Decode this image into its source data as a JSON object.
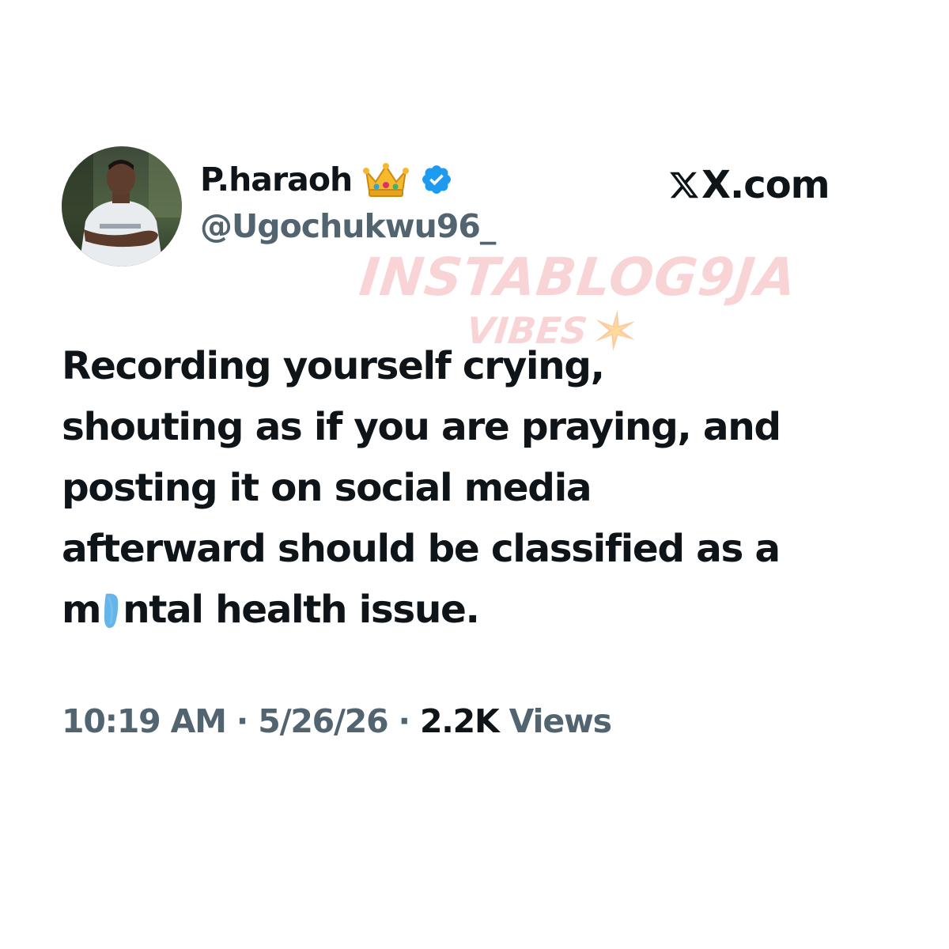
{
  "tweet": {
    "author": {
      "display_name": "P.haraoh",
      "handle": "@Ugochukwu96_",
      "badges": [
        "crown-emoji",
        "verified-icon"
      ],
      "verified_color": "#1d9bf0"
    },
    "site_label": "X.com",
    "text_lines": [
      "Recording yourself crying,",
      "shouting as if you are praying, and",
      "posting it on social media",
      "afterward should be classified as a"
    ],
    "last_line": {
      "before": "m",
      "after": "ntal health issue."
    },
    "meta": {
      "time": "10:19 AM",
      "separator": " · ",
      "date": "5/26/26",
      "views_count": "2.2K",
      "views_label": "Views"
    }
  },
  "watermark": {
    "main": "INSTABLOG9JA",
    "sub": "VIBES"
  },
  "colors": {
    "text_primary": "#0f1419",
    "text_secondary": "#536471",
    "scribble": "#4aa8e8",
    "watermark": "#ec7a80"
  }
}
